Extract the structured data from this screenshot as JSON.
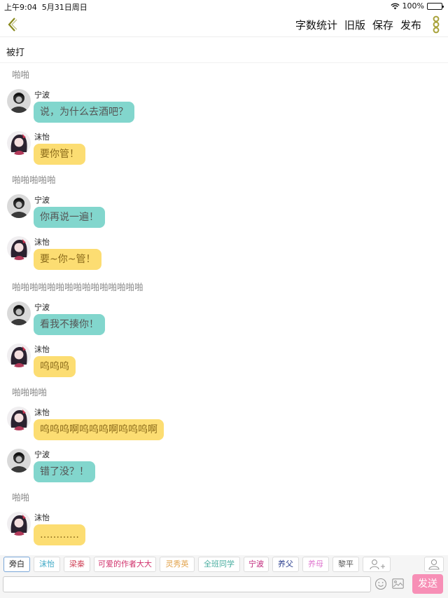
{
  "status_bar": {
    "time": "上午9:04",
    "date": "5月31日周日",
    "battery": "100%"
  },
  "nav": {
    "actions": [
      "字数统计",
      "旧版",
      "保存",
      "发布"
    ]
  },
  "chapter_title": "被打",
  "chat": [
    {
      "type": "narration",
      "text": "啪啪"
    },
    {
      "type": "message",
      "name": "宁波",
      "text": "说，为什么去酒吧？",
      "style": "teal"
    },
    {
      "type": "message",
      "name": "沫怡",
      "text": "要你管！",
      "style": "yellow"
    },
    {
      "type": "narration",
      "text": "啪啪啪啪啪"
    },
    {
      "type": "message",
      "name": "宁波",
      "text": "你再说一遍！",
      "style": "teal"
    },
    {
      "type": "message",
      "name": "沫怡",
      "text": "要~你~管！",
      "style": "yellow"
    },
    {
      "type": "narration",
      "text": "啪啪啪啪啪啪啪啪啪啪啪啪啪啪啪"
    },
    {
      "type": "message",
      "name": "宁波",
      "text": "看我不揍你！",
      "style": "teal"
    },
    {
      "type": "message",
      "name": "沫怡",
      "text": "呜呜呜",
      "style": "yellow"
    },
    {
      "type": "narration",
      "text": "啪啪啪啪"
    },
    {
      "type": "message",
      "name": "沫怡",
      "text": "呜呜呜啊呜呜呜啊呜呜呜啊",
      "style": "yellow"
    },
    {
      "type": "message",
      "name": "宁波",
      "text": "错了没？！",
      "style": "teal"
    },
    {
      "type": "narration",
      "text": "啪啪"
    },
    {
      "type": "message",
      "name": "沫怡",
      "text": "…………",
      "style": "yellow"
    }
  ],
  "roles": [
    {
      "label": "旁白",
      "color": "#222222"
    },
    {
      "label": "沫怡",
      "color": "#3aa7c4"
    },
    {
      "label": "梁秦",
      "color": "#d0455a"
    },
    {
      "label": "可爱的作者大大",
      "color": "#d0306b"
    },
    {
      "label": "灵秀英",
      "color": "#e2a24a"
    },
    {
      "label": "全班同学",
      "color": "#4aaea0"
    },
    {
      "label": "宁波",
      "color": "#c0267a"
    },
    {
      "label": "养父",
      "color": "#2b3f8e"
    },
    {
      "label": "养母",
      "color": "#e07ad0"
    },
    {
      "label": "黎平",
      "color": "#555555"
    }
  ],
  "selected_role": "旁白",
  "composer": {
    "input_value": "",
    "send_label": "发送"
  },
  "colors": {
    "teal_bubble": "#82d6cd",
    "yellow_bubble": "#fcdd72",
    "send_button": "#f78fb6",
    "accent_olive": "#8a8a1e"
  },
  "icons": {
    "back": "chevron-left-icon",
    "more": "more-vertical-icon",
    "add_role": "add-person-icon",
    "person": "person-icon",
    "emoji": "emoji-icon",
    "image": "image-icon",
    "wifi": "wifi-icon",
    "battery": "battery-icon"
  }
}
